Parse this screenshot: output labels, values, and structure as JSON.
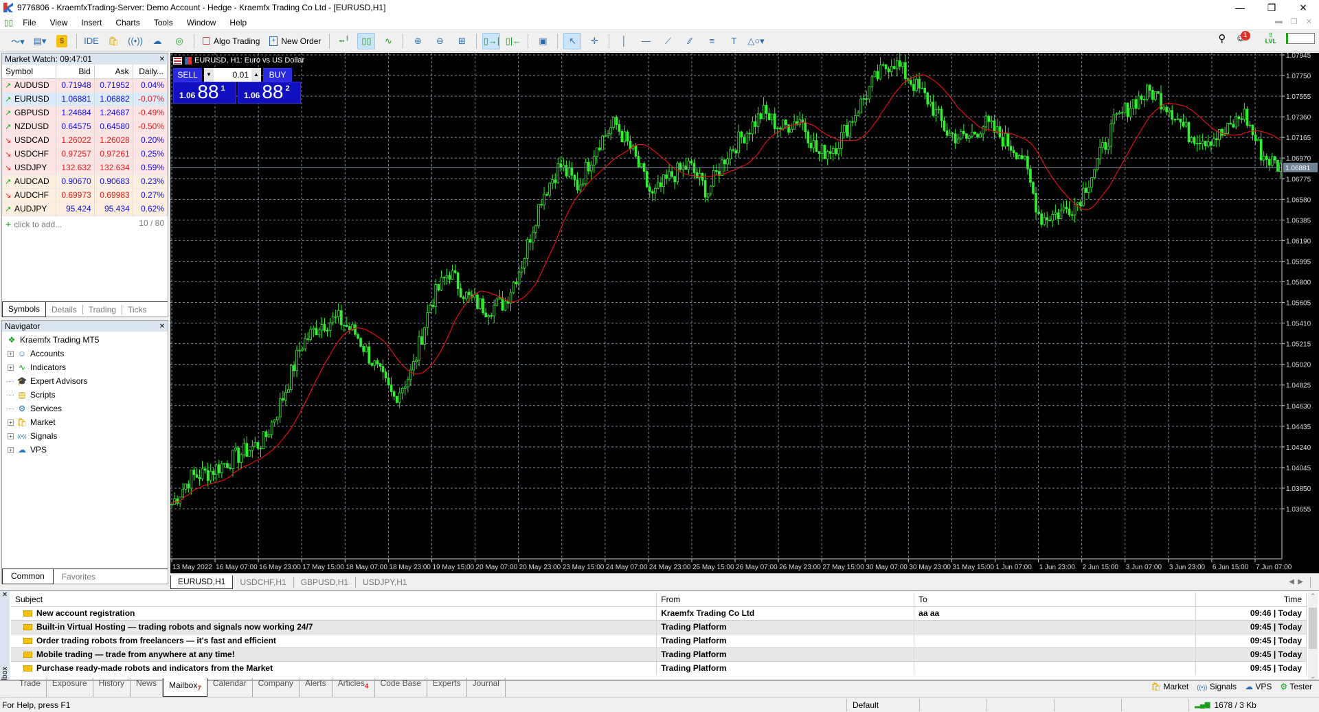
{
  "window": {
    "title": "9776806 - KraemfxTrading-Server: Demo Account - Hedge - Kraemfx Trading Co Ltd - [EURUSD,H1]",
    "controls": [
      "minimize",
      "restore",
      "close"
    ]
  },
  "menu": [
    "File",
    "View",
    "Insert",
    "Charts",
    "Tools",
    "Window",
    "Help"
  ],
  "toolbar": {
    "ide_label": "IDE",
    "algo_trading_label": "Algo Trading",
    "new_order_label": "New Order",
    "notification_count": "1",
    "lvl_label": "LVL"
  },
  "market_watch": {
    "title": "Market Watch: 09:47:01",
    "columns": [
      "Symbol",
      "Bid",
      "Ask",
      "Daily..."
    ],
    "rows": [
      {
        "symbol": "AUDUSD",
        "dir": "up",
        "bid": "0.71948",
        "ask": "0.71952",
        "daily": "0.04%",
        "price_color": "blue",
        "daily_color": "blue",
        "bg": "#fde4e4"
      },
      {
        "symbol": "EURUSD",
        "dir": "up",
        "bid": "1.06881",
        "ask": "1.06882",
        "daily": "-0.07%",
        "price_color": "blue",
        "daily_color": "red",
        "bg": "#dcebfa"
      },
      {
        "symbol": "GBPUSD",
        "dir": "up",
        "bid": "1.24684",
        "ask": "1.24687",
        "daily": "-0.49%",
        "price_color": "blue",
        "daily_color": "red",
        "bg": "#fde4e4"
      },
      {
        "symbol": "NZDUSD",
        "dir": "up",
        "bid": "0.64575",
        "ask": "0.64580",
        "daily": "-0.50%",
        "price_color": "blue",
        "daily_color": "red",
        "bg": "#fde4e4"
      },
      {
        "symbol": "USDCAD",
        "dir": "down",
        "bid": "1.26022",
        "ask": "1.26028",
        "daily": "0.20%",
        "price_color": "red",
        "daily_color": "blue",
        "bg": "#fde4e4"
      },
      {
        "symbol": "USDCHF",
        "dir": "down",
        "bid": "0.97257",
        "ask": "0.97261",
        "daily": "0.25%",
        "price_color": "red",
        "daily_color": "blue",
        "bg": "#fde4e4"
      },
      {
        "symbol": "USDJPY",
        "dir": "down",
        "bid": "132.632",
        "ask": "132.634",
        "daily": "0.59%",
        "price_color": "red",
        "daily_color": "blue",
        "bg": "#fde4e4"
      },
      {
        "symbol": "AUDCAD",
        "dir": "up",
        "bid": "0.90670",
        "ask": "0.90683",
        "daily": "0.23%",
        "price_color": "blue",
        "daily_color": "blue",
        "bg": "#fdefe0"
      },
      {
        "symbol": "AUDCHF",
        "dir": "down",
        "bid": "0.69973",
        "ask": "0.69983",
        "daily": "0.27%",
        "price_color": "red",
        "daily_color": "blue",
        "bg": "#fdefe0"
      },
      {
        "symbol": "AUDJPY",
        "dir": "up",
        "bid": "95.424",
        "ask": "95.434",
        "daily": "0.62%",
        "price_color": "blue",
        "daily_color": "blue",
        "bg": "#fdefe0"
      }
    ],
    "add_label": "click to add...",
    "count": "10 / 80",
    "tabs": [
      "Symbols",
      "Details",
      "Trading",
      "Ticks"
    ],
    "active_tab": "Symbols"
  },
  "navigator": {
    "title": "Navigator",
    "root": "Kraemfx Trading MT5",
    "items": [
      {
        "label": "Accounts",
        "expandable": true,
        "icon": "accounts-icon"
      },
      {
        "label": "Indicators",
        "expandable": true,
        "icon": "indicators-icon"
      },
      {
        "label": "Expert Advisors",
        "expandable": false,
        "icon": "expert-advisors-icon"
      },
      {
        "label": "Scripts",
        "expandable": false,
        "icon": "scripts-icon"
      },
      {
        "label": "Services",
        "expandable": false,
        "icon": "services-icon"
      },
      {
        "label": "Market",
        "expandable": true,
        "icon": "market-icon"
      },
      {
        "label": "Signals",
        "expandable": true,
        "icon": "signals-icon"
      },
      {
        "label": "VPS",
        "expandable": true,
        "icon": "vps-icon"
      }
    ],
    "tabs": [
      "Common",
      "Favorites"
    ],
    "active_tab": "Common"
  },
  "trade_panel": {
    "header": "EURUSD, H1:  Euro vs US Dollar",
    "sell_label": "SELL",
    "buy_label": "BUY",
    "lot": "0.01",
    "sell_price": {
      "prefix": "1.06",
      "big": "88",
      "sup": "1"
    },
    "buy_price": {
      "prefix": "1.06",
      "big": "88",
      "sup": "2"
    }
  },
  "chart_data": {
    "type": "candlestick",
    "title": "EURUSD, H1: Euro vs US Dollar",
    "symbol": "EURUSD",
    "timeframe": "H1",
    "ylim": [
      1.035,
      1.08
    ],
    "y_ticks": [
      "1.07945",
      "1.07750",
      "1.07555",
      "1.07360",
      "1.07165",
      "1.06970",
      "1.06775",
      "1.06580",
      "1.06385",
      "1.06190",
      "1.05995",
      "1.05800",
      "1.05605",
      "1.05410",
      "1.05215",
      "1.05020",
      "1.04825",
      "1.04630",
      "1.04435",
      "1.04240",
      "1.04045",
      "1.03850",
      "1.03655"
    ],
    "x_ticks": [
      "13 May 2022",
      "16 May 07:00",
      "16 May 23:00",
      "17 May 15:00",
      "18 May 07:00",
      "18 May 23:00",
      "19 May 15:00",
      "20 May 07:00",
      "20 May 23:00",
      "23 May 15:00",
      "24 May 07:00",
      "24 May 23:00",
      "25 May 15:00",
      "26 May 07:00",
      "26 May 23:00",
      "27 May 15:00",
      "30 May 07:00",
      "30 May 23:00",
      "31 May 15:00",
      "1 Jun 07:00",
      "1 Jun 23:00",
      "2 Jun 15:00",
      "3 Jun 07:00",
      "3 Jun 23:00",
      "6 Jun 15:00",
      "7 Jun 07:00"
    ],
    "current_bid": 1.06881,
    "current_bid_label": "1.06881",
    "price_waypoints": [
      1.037,
      1.0395,
      1.04,
      1.041,
      1.042,
      1.043,
      1.047,
      1.052,
      1.054,
      1.0545,
      1.053,
      1.05,
      1.047,
      1.0495,
      1.056,
      1.059,
      1.0565,
      1.0555,
      1.056,
      1.06,
      1.066,
      1.069,
      1.067,
      1.071,
      1.073,
      1.07,
      1.066,
      1.068,
      1.069,
      1.0665,
      1.07,
      1.072,
      1.074,
      1.0725,
      1.0735,
      1.07,
      1.071,
      1.074,
      1.077,
      1.079,
      1.077,
      1.075,
      1.072,
      1.0715,
      1.073,
      1.0715,
      1.07,
      1.064,
      1.0645,
      1.0655,
      1.069,
      1.073,
      1.075,
      1.076,
      1.0745,
      1.072,
      1.0715,
      1.072,
      1.074,
      1.07,
      1.0688
    ],
    "ma_color": "#e01010",
    "candle_color": "#33ee33",
    "series": [
      {
        "name": "Moving Average",
        "color": "#e01010"
      }
    ]
  },
  "chart_tabs": [
    "EURUSD,H1",
    "USDCHF,H1",
    "GBPUSD,H1",
    "USDJPY,H1"
  ],
  "active_chart_tab": "EURUSD,H1",
  "mailbox": {
    "columns": [
      "Subject",
      "From",
      "To",
      "Time"
    ],
    "rows": [
      {
        "subject": "New account registration",
        "from": "Kraemfx Trading Co Ltd",
        "to": "aa aa",
        "time": "09:46 | Today"
      },
      {
        "subject": "Built-in Virtual Hosting — trading robots and signals now working 24/7",
        "from": "Trading Platform",
        "to": "",
        "time": "09:45 | Today"
      },
      {
        "subject": "Order trading robots from freelancers — it's fast and efficient",
        "from": "Trading Platform",
        "to": "",
        "time": "09:45 | Today"
      },
      {
        "subject": "Mobile trading — trade from anywhere at any time!",
        "from": "Trading Platform",
        "to": "",
        "time": "09:45 | Today"
      },
      {
        "subject": "Purchase ready-made robots and indicators from the Market",
        "from": "Trading Platform",
        "to": "",
        "time": "09:45 | Today"
      }
    ]
  },
  "toolbox": {
    "label": "Toolbox",
    "tabs": [
      {
        "label": "Trade"
      },
      {
        "label": "Exposure"
      },
      {
        "label": "History"
      },
      {
        "label": "News"
      },
      {
        "label": "Mailbox",
        "badge": "7",
        "active": true
      },
      {
        "label": "Calendar"
      },
      {
        "label": "Company"
      },
      {
        "label": "Alerts"
      },
      {
        "label": "Articles",
        "badge": "4"
      },
      {
        "label": "Code Base"
      },
      {
        "label": "Experts"
      },
      {
        "label": "Journal"
      }
    ],
    "right_links": [
      "Market",
      "Signals",
      "VPS",
      "Tester"
    ]
  },
  "status_bar": {
    "help": "For Help, press F1",
    "profile": "Default",
    "connection": "1678 / 3 Kb"
  }
}
